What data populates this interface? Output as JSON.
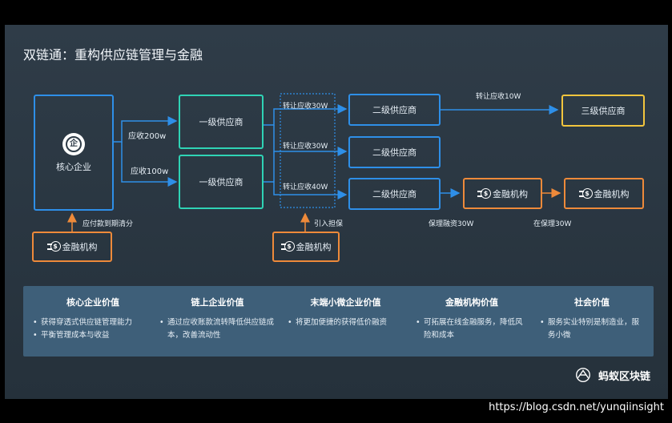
{
  "title": "双链通：重构供应链管理与金融",
  "nodes": {
    "core": "核心企业",
    "core_icon_char": "企",
    "tier1_a": "一级供应商",
    "tier1_b": "一级供应商",
    "tier2_a": "二级供应商",
    "tier2_b": "二级供应商",
    "tier2_c": "二级供应商",
    "tier3": "三级供应商",
    "fin_left": "金融机构",
    "fin_mid": "金融机构",
    "fin_right1": "金融机构",
    "fin_right2": "金融机构"
  },
  "edges": {
    "receive_200": "应收200w",
    "receive_100": "应收100w",
    "transfer_30_a": "转让应收30W",
    "transfer_30_b": "转让应收30W",
    "transfer_40": "转让应收40W",
    "transfer_10": "转让应收10W",
    "pay_clear": "应付款到期清分",
    "guarantee": "引入担保",
    "factoring": "保理融资30W",
    "refactoring": "在保理30W"
  },
  "values": [
    {
      "title": "核心企业价值",
      "items": [
        "获得穿透式供应链管理能力",
        "平衡管理成本与收益"
      ]
    },
    {
      "title": "链上企业价值",
      "items": [
        "通过应收账款流转降低供应链成本，改善流动性"
      ]
    },
    {
      "title": "末端小微企业价值",
      "items": [
        "将更加便捷的获得低价融资"
      ]
    },
    {
      "title": "金融机构价值",
      "items": [
        "可拓展在线金融服务，降低风险和成本"
      ]
    },
    {
      "title": "社会价值",
      "items": [
        "服务实业特别是制造业，服务小微"
      ]
    }
  ],
  "logo": "蚂蚁区块链",
  "watermark": "https://blog.csdn.net/yunqiinsight",
  "colors": {
    "blue": "#2e8fe8",
    "green": "#2fd3b5",
    "orange": "#ee8a3a",
    "yellow": "#f2c53d",
    "panel": "#3e5f79"
  }
}
